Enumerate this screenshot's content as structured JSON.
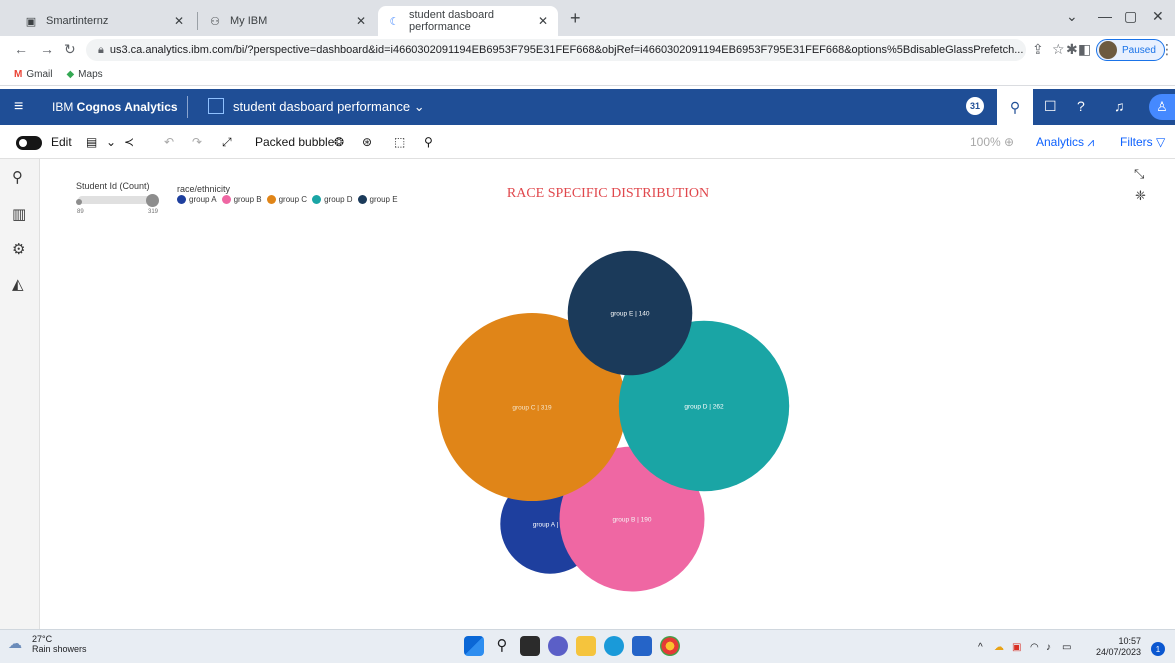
{
  "browser": {
    "tabs": [
      {
        "label": "Smartinternz",
        "icon": "smartinternz-icon"
      },
      {
        "label": "My IBM",
        "icon": "ibm-icon"
      },
      {
        "label": "student dasboard performance",
        "icon": "cognos-icon"
      }
    ],
    "url": "us3.ca.analytics.ibm.com/bi/?perspective=dashboard&id=i4660302091194EB6953F795E31FEF668&objRef=i4660302091194EB6953F795E31FEF668&options%5BdisableGlassPrefetch...",
    "profile_status": "Paused",
    "bookmarks": [
      "Gmail",
      "Maps"
    ]
  },
  "ibm": {
    "brand_prefix": "IBM ",
    "brand_product": "Cognos Analytics",
    "dashboard_name": "student dasboard performance",
    "badge": "31"
  },
  "toolbar": {
    "edit_label": "Edit",
    "visualization_type": "Packed bubble",
    "zoom": "100%",
    "analytics_label": "Analytics",
    "filters_label": "Filters"
  },
  "chart": {
    "title": "RACE SPECIFIC DISTRIBUTION",
    "size_legend_title": "Student Id (Count)",
    "size_min_label": "89",
    "size_max_label": "319",
    "color_legend_title": "race/ethnicity"
  },
  "chart_data": {
    "type": "packed-bubble",
    "title": "RACE SPECIFIC DISTRIBUTION",
    "size_measure": "Student Id (Count)",
    "color_dimension": "race/ethnicity",
    "categories": [
      "group A",
      "group B",
      "group C",
      "group D",
      "group E"
    ],
    "values": [
      89,
      190,
      319,
      262,
      140
    ],
    "colors": [
      "#1e3f9e",
      "#ef67a3",
      "#e08518",
      "#1aa5a5",
      "#1b3a5a"
    ],
    "labels": [
      "group A | 89",
      "group B | 190",
      "group C | 319",
      "group D | 262",
      "group E | 140"
    ]
  },
  "taskbar": {
    "temperature": "27°C",
    "weather": "Rain showers",
    "time": "10:57",
    "date": "24/07/2023",
    "notifications": "1"
  }
}
